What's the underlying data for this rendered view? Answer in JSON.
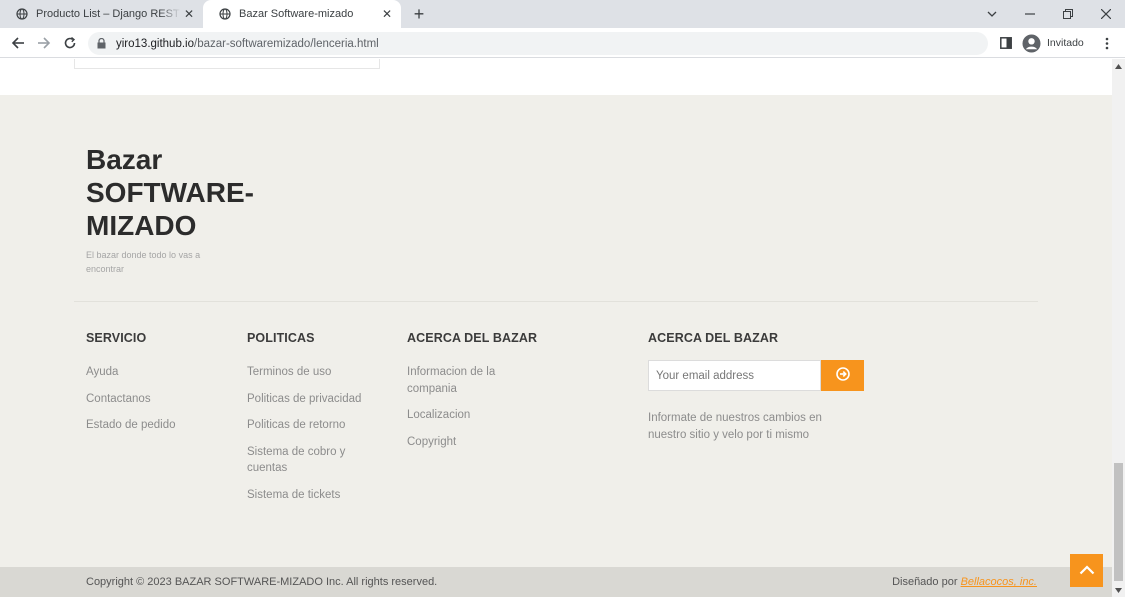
{
  "browser": {
    "tabs": [
      {
        "title": "Producto List – Django REST fram",
        "active": false
      },
      {
        "title": "Bazar Software-mizado",
        "active": true
      }
    ],
    "url_host": "yiro13.github.io",
    "url_path": "/bazar-softwaremizado/lenceria.html",
    "profile_label": "Invitado"
  },
  "footer": {
    "brand": "Bazar SOFTWARE-MIZADO",
    "tagline": "El bazar donde todo lo vas a encontrar",
    "columns": [
      {
        "title": "SERVICIO",
        "links": [
          "Ayuda",
          "Contactanos",
          "Estado de pedido"
        ]
      },
      {
        "title": "POLITICAS",
        "links": [
          "Terminos de uso",
          "Politicas de privacidad",
          "Politicas de retorno",
          "Sistema de cobro y cuentas",
          "Sistema de tickets"
        ]
      },
      {
        "title": "ACERCA DEL BAZAR",
        "links": [
          "Informacion de la compania",
          "Localizacion",
          "Copyright"
        ]
      }
    ],
    "newsletter": {
      "title": "ACERCA DEL BAZAR",
      "email_placeholder": "Your email address",
      "text": "Informate de nuestros cambios en nuestro sitio y velo por ti mismo"
    },
    "copyright": "Copyright © 2023 BAZAR SOFTWARE-MIZADO Inc. All rights reserved.",
    "designed_by_label": "Diseñado por",
    "designed_by_link": "Bellacocos, inc."
  },
  "colors": {
    "accent": "#f7941d",
    "footer_bg": "#f0efea",
    "bottom_bar_bg": "#d9d8d3"
  },
  "icons": {
    "tab_favicon": "globe-icon",
    "back_to_top": "chevron-up-icon",
    "subscribe": "arrow-circle-right-icon"
  }
}
